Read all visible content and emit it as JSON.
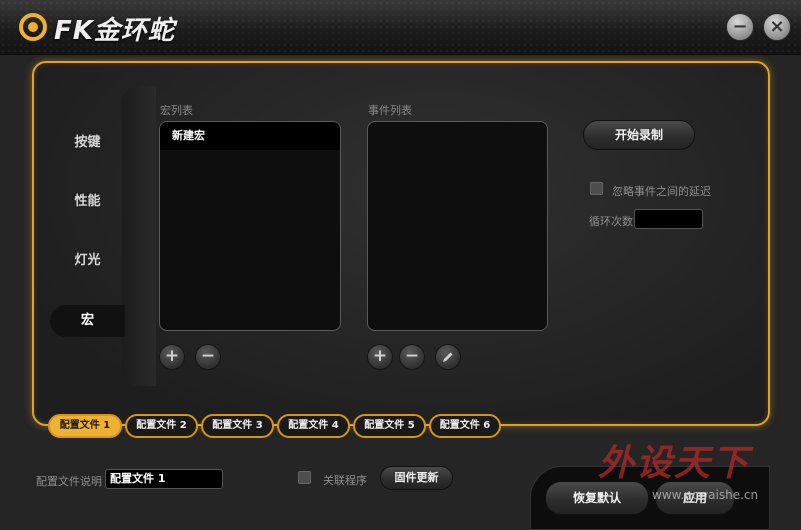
{
  "app": {
    "title": "FK金环蛇"
  },
  "window_controls": {
    "minimize": "−",
    "close": "×"
  },
  "sidebar": {
    "items": [
      {
        "label": "按键"
      },
      {
        "label": "性能"
      },
      {
        "label": "灯光"
      },
      {
        "label": "宏"
      }
    ]
  },
  "macro_list": {
    "label": "宏列表",
    "items": [
      "新建宏"
    ]
  },
  "event_list": {
    "label": "事件列表",
    "items": []
  },
  "buttons": {
    "add": "+",
    "remove": "−",
    "start_record": "开始录制",
    "firmware_update": "固件更新",
    "restore_default": "恢复默认",
    "apply": "应用"
  },
  "options": {
    "ignore_delay": "忽略事件之间的延迟",
    "loop_count": "循环次数",
    "loop_count_value": "",
    "link_program": "关联程序"
  },
  "profile": {
    "description_label": "配置文件说明",
    "description_value": "配置文件 1",
    "tabs": [
      "配置文件 1",
      "配置文件 2",
      "配置文件 3",
      "配置文件 4",
      "配置文件 5",
      "配置文件 6"
    ]
  },
  "watermark": {
    "text": "外设天下",
    "url": "www.pcwaishe.cn"
  },
  "colors": {
    "accent": "#e0a12a",
    "background": "#252525",
    "active_tab": "#f0b030"
  }
}
